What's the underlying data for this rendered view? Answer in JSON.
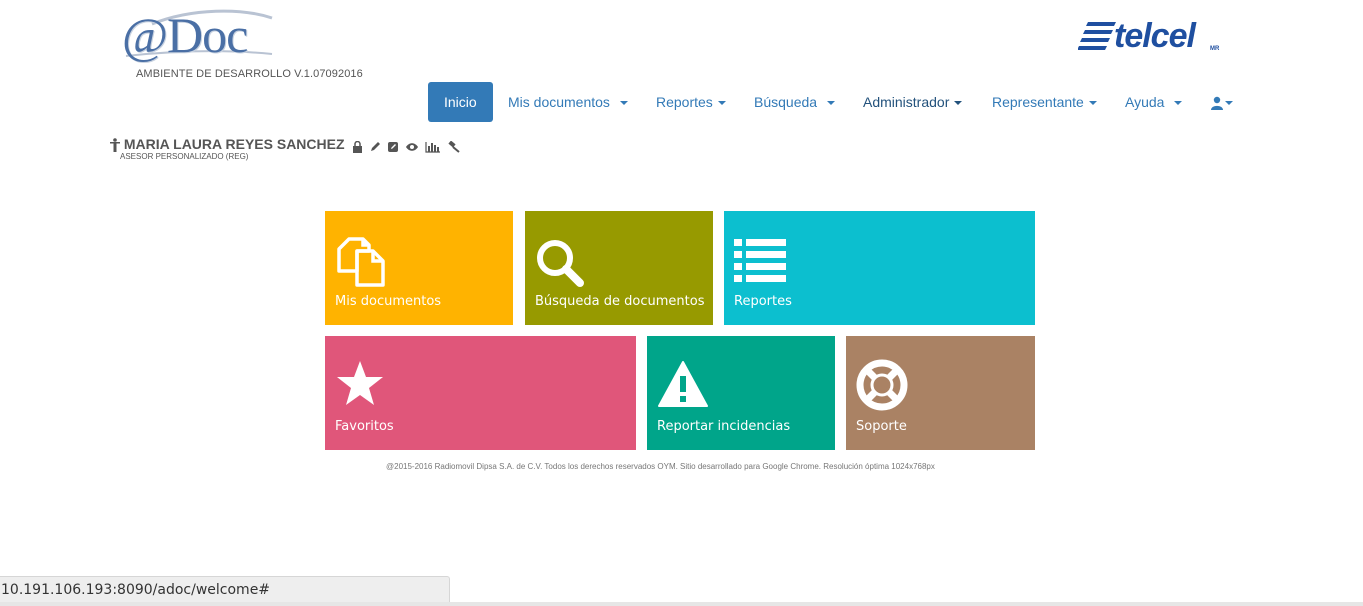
{
  "header": {
    "logo_text": "@Doc",
    "environment": "AMBIENTE DE DESARROLLO V.1.07092016",
    "brand": "telcel",
    "brand_sub": "MR"
  },
  "nav": {
    "items": [
      {
        "label": "Inicio",
        "active": true
      },
      {
        "label": "Mis documentos"
      },
      {
        "label": "Reportes"
      },
      {
        "label": "Búsqueda"
      },
      {
        "label": "Administrador"
      },
      {
        "label": "Representante"
      },
      {
        "label": "Ayuda"
      }
    ],
    "user_menu_icon": "user-icon"
  },
  "user": {
    "name": "MARIA LAURA REYES SANCHEZ",
    "role": "ASESOR PERSONALIZADO (REG)",
    "icons": [
      "lock-icon",
      "pencil-icon",
      "edit-icon",
      "eye-icon",
      "chart-icon",
      "gavel-icon"
    ]
  },
  "tiles": [
    {
      "label": "Mis documentos",
      "icon": "documents-icon",
      "color": "#ffb300"
    },
    {
      "label": "Búsqueda de documentos",
      "icon": "search-icon",
      "color": "#979a00"
    },
    {
      "label": "Reportes",
      "icon": "list-icon",
      "color": "#0cbfcf"
    },
    {
      "label": "Favoritos",
      "icon": "star-icon",
      "color": "#e0567a"
    },
    {
      "label": "Reportar incidencias",
      "icon": "warning-icon",
      "color": "#00a58a"
    },
    {
      "label": "Soporte",
      "icon": "lifebuoy-icon",
      "color": "#aa8264"
    }
  ],
  "footer": {
    "text": "@2015-2016 Radiomovil Dipsa S.A. de C.V. Todos los derechos reservados OYM. Sitio desarrollado para Google Chrome. Resolución óptima 1024x768px"
  },
  "statusbar": {
    "url": "10.191.106.193:8090/adoc/welcome#"
  }
}
